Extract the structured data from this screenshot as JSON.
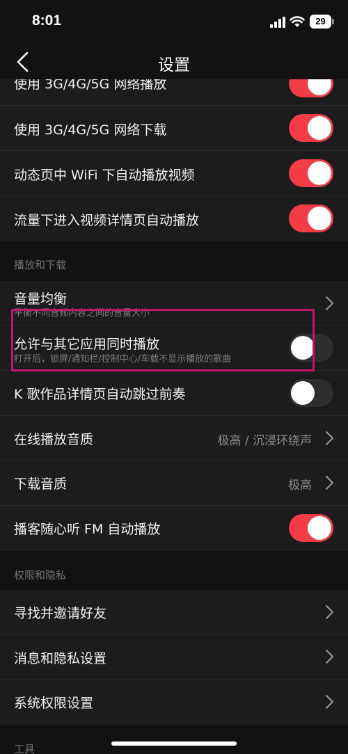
{
  "status_bar": {
    "time": "8:01",
    "battery": "29"
  },
  "header": {
    "title": "设置"
  },
  "rows_top": [
    {
      "label": "使用 3G/4G/5G 网络播放",
      "toggle": "on"
    },
    {
      "label": "使用 3G/4G/5G 网络下载",
      "toggle": "on"
    },
    {
      "label": "动态页中 WiFi 下自动播放视频",
      "toggle": "on"
    },
    {
      "label": "流量下进入视频详情页自动播放",
      "toggle": "on"
    }
  ],
  "sections": {
    "playback": "播放和下载",
    "privacy": "权限和隐私",
    "tools": "工具"
  },
  "playback_rows": {
    "volume_balance": {
      "label": "音量均衡",
      "sub": "平衡不同音频内容之间的音量大小"
    },
    "allow_simultaneous": {
      "label": "允许与其它应用同时播放",
      "sub": "打开后，锁屏/通知栏/控制中心/车载不显示播放的歌曲",
      "toggle": "off"
    },
    "ksong_skip_intro": {
      "label": "K 歌作品详情页自动跳过前奏",
      "toggle": "off"
    },
    "online_quality": {
      "label": "在线播放音质",
      "value": "极高 / 沉浸环绕声"
    },
    "download_quality": {
      "label": "下载音质",
      "value": "极高"
    },
    "podcast_fm": {
      "label": "播客随心听 FM 自动播放",
      "toggle": "on"
    }
  },
  "privacy_rows": {
    "invite_friends": {
      "label": "寻找并邀请好友"
    },
    "message_privacy": {
      "label": "消息和隐私设置"
    },
    "system_permissions": {
      "label": "系统权限设置"
    }
  },
  "colors": {
    "accent": "#f23d47",
    "highlight": "#c5166d",
    "background": "#121212",
    "row": "#1c1c1c"
  }
}
